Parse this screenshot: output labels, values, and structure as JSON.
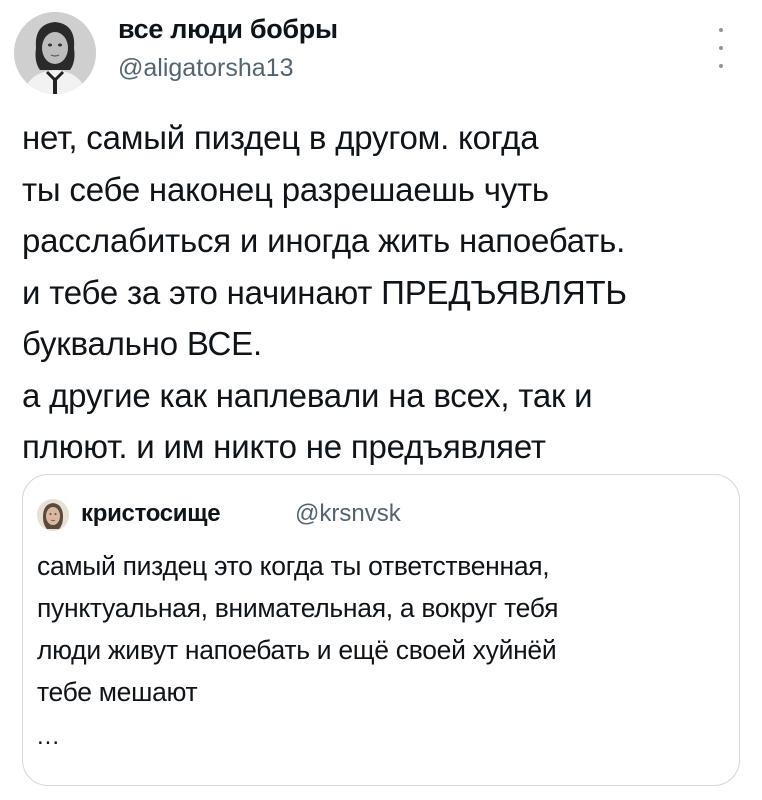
{
  "tweet": {
    "author_name": "все люди бобры",
    "author_handle": "@aligatorsha13",
    "more_icon": "more-vertical-icon",
    "text_lines": [
      "нет, самый пиздец в другом. когда",
      "ты себе наконец разрешаешь чуть",
      "расслабиться и иногда жить напоебать.",
      "и тебе за это начинают ПРЕДЪЯВЛЯТЬ",
      "буквально ВСЕ.",
      "а другие как наплевали на всех, так и",
      "плюют. и им никто не предъявляет"
    ]
  },
  "quote": {
    "author_name": "кристосище",
    "author_handle": "@krsnvsk",
    "text_lines": [
      "самый пиздец это когда ты ответственная,",
      "пунктуальная, внимательная, а вокруг тебя",
      "люди живут напоебать и ещё своей хуйнёй",
      "тебе мешают"
    ],
    "ellipsis": "..."
  },
  "colors": {
    "text": "#0f1419",
    "secondary": "#536471",
    "border": "#cfd9de"
  }
}
